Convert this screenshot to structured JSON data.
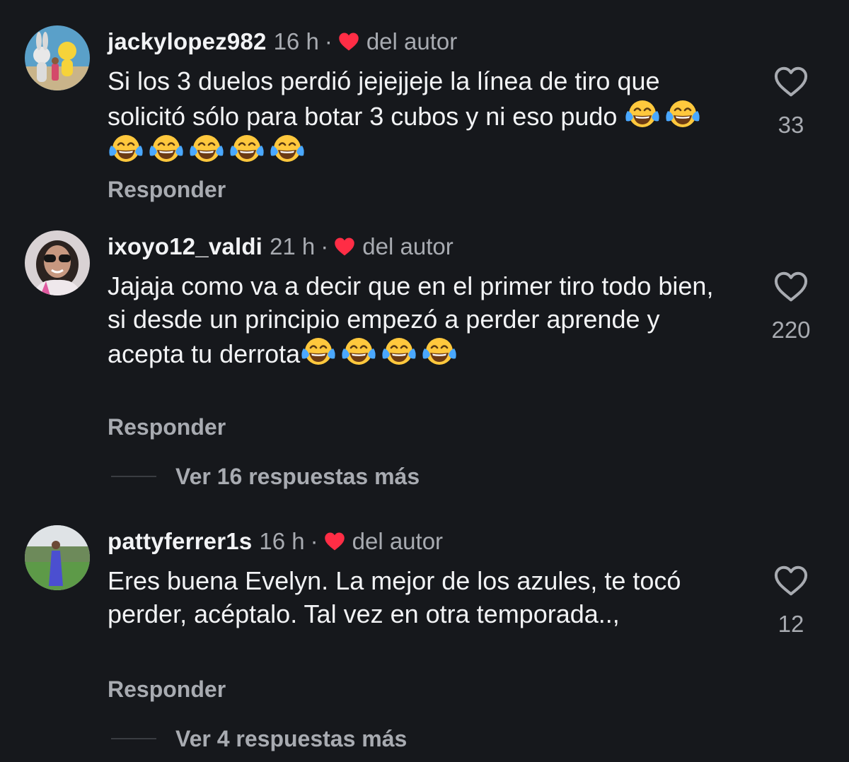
{
  "comments": [
    {
      "username": "jackylopez982",
      "time": "16 h",
      "separator": "·",
      "author_label": "del autor",
      "text": "Si los 3 duelos perdió jejejjeje la línea de tiro que solicitó sólo para botar 3 cubos y ni eso pudo",
      "emojis": [
        "face-with-tears-of-joy",
        "face-with-tears-of-joy",
        "face-with-tears-of-joy",
        "face-with-tears-of-joy",
        "face-with-tears-of-joy",
        "face-with-tears-of-joy",
        "face-with-tears-of-joy"
      ],
      "reply_label": "Responder",
      "likes": "33"
    },
    {
      "username": "ixoyo12_valdi",
      "time": "21 h",
      "separator": "·",
      "author_label": "del autor",
      "text": "Jajaja como va a decir que en el primer tiro todo bien, si desde un principio empezó a perder aprende y acepta tu derrota",
      "emojis": [
        "face-with-tears-of-joy",
        "face-with-tears-of-joy",
        "face-with-tears-of-joy",
        "face-with-tears-of-joy"
      ],
      "reply_label": "Responder",
      "likes": "220",
      "more_replies": "Ver 16 respuestas más"
    },
    {
      "username": "pattyferrer1s",
      "time": "16 h",
      "separator": "·",
      "author_label": "del autor",
      "text": "Eres buena Evelyn. La mejor de los azules, te tocó perder, acéptalo. Tal vez en otra temporada..,",
      "emojis": [],
      "reply_label": "Responder",
      "likes": "12",
      "more_replies": "Ver 4 respuestas más"
    }
  ],
  "colors": {
    "background": "#16181c",
    "primary_text": "#f2f3f5",
    "secondary_text": "#a8abb1",
    "author_heart": "#ff2d45"
  },
  "icons": {
    "author_like": "red-heart-icon",
    "like_button": "heart-outline-icon",
    "emoji": "face-with-tears-of-joy"
  }
}
